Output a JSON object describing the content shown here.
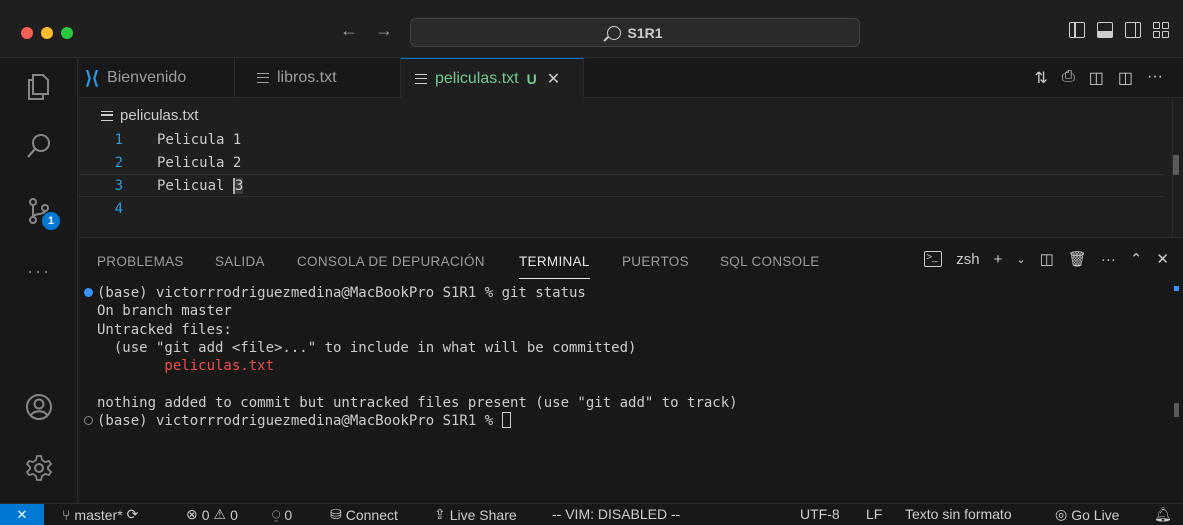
{
  "titlebar": {
    "search_text": "S1R1",
    "back_icon": "arrow-left-icon",
    "forward_icon": "arrow-right-icon"
  },
  "tabs": [
    {
      "label": "Bienvenido",
      "icon": "vscode-logo-icon",
      "active": false
    },
    {
      "label": "libros.txt",
      "icon": "text-file-icon",
      "active": false
    },
    {
      "label": "peliculas.txt",
      "icon": "text-file-icon",
      "active": true,
      "status": "U",
      "close": "✕"
    }
  ],
  "editor": {
    "breadcrumb": "peliculas.txt",
    "lines": [
      {
        "num": "1",
        "text": "Pelicula 1"
      },
      {
        "num": "2",
        "text": "Pelicula 2"
      },
      {
        "num": "3",
        "text": "Pelicual ",
        "cursor_char": "3"
      },
      {
        "num": "4",
        "text": ""
      }
    ]
  },
  "activity": {
    "scm_badge": "1",
    "more": "···"
  },
  "panel": {
    "tabs": [
      "PROBLEMAS",
      "SALIDA",
      "CONSOLA DE DEPURACIÓN",
      "TERMINAL",
      "PUERTOS",
      "SQL CONSOLE"
    ],
    "active_tab": "TERMINAL",
    "shell": "zsh",
    "terminal": {
      "line1": "(base) victorrrodriguezmedina@MacBookPro S1R1 % git status",
      "line2": "On branch master",
      "line3": "Untracked files:",
      "line4": "  (use \"git add <file>...\" to include in what will be committed)",
      "line5": "        peliculas.txt",
      "line6": "",
      "line7": "nothing added to commit but untracked files present (use \"git add\" to track)",
      "line8": "(base) victorrrodriguezmedina@MacBookPro S1R1 % "
    }
  },
  "statusbar": {
    "branch": "master*",
    "errors": "0",
    "warnings": "0",
    "ports": "0",
    "connect": "Connect",
    "live_share": "Live Share",
    "vim": "-- VIM: DISABLED --",
    "encoding": "UTF-8",
    "eol": "LF",
    "language": "Texto sin formato",
    "go_live": "Go Live"
  },
  "colors": {
    "accent": "#0078d4",
    "modified_green": "#73c991",
    "untracked_red": "#f14c4c",
    "line_number_blue": "#2b9bd8"
  }
}
